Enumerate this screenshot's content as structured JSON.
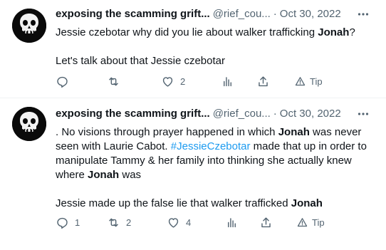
{
  "tweets": [
    {
      "display_name": "exposing the scamming grift...",
      "handle": "@rief_cou...",
      "separator": "·",
      "date": "Oct 30, 2022",
      "body": {
        "p1_a": "Jessie czebotar why did you lie about walker trafficking ",
        "p1_b": "Jonah",
        "p1_c": "?",
        "p2": "Let's talk about that Jessie czebotar"
      },
      "actions": {
        "reply_count": "",
        "retweet_count": "",
        "like_count": "2",
        "tip_label": "Tip"
      }
    },
    {
      "display_name": "exposing the scamming grift...",
      "handle": "@rief_cou...",
      "separator": "·",
      "date": "Oct 30, 2022",
      "body": {
        "p1_a": ". No visions through prayer happened in which ",
        "p1_b": "Jonah",
        "p1_c": " was never seen with Laurie Cabot. ",
        "p1_hashtag": "#JessieCzebotar",
        "p1_d": " made that up in order to manipulate Tammy & her family into thinking she actually knew where ",
        "p1_e": "Jonah",
        "p1_f": " was",
        "p2_a": "Jessie made up the false lie that walker trafficked ",
        "p2_b": "Jonah"
      },
      "actions": {
        "reply_count": "1",
        "retweet_count": "2",
        "like_count": "4",
        "tip_label": "Tip"
      }
    }
  ],
  "colors": {
    "text": "#0f1419",
    "secondary": "#536471",
    "link": "#1d9bf0",
    "divider": "#eff3f4"
  },
  "icons": [
    "more-icon",
    "reply-icon",
    "retweet-icon",
    "like-icon",
    "views-icon",
    "share-icon",
    "tip-icon",
    "punisher-skull-avatar"
  ]
}
